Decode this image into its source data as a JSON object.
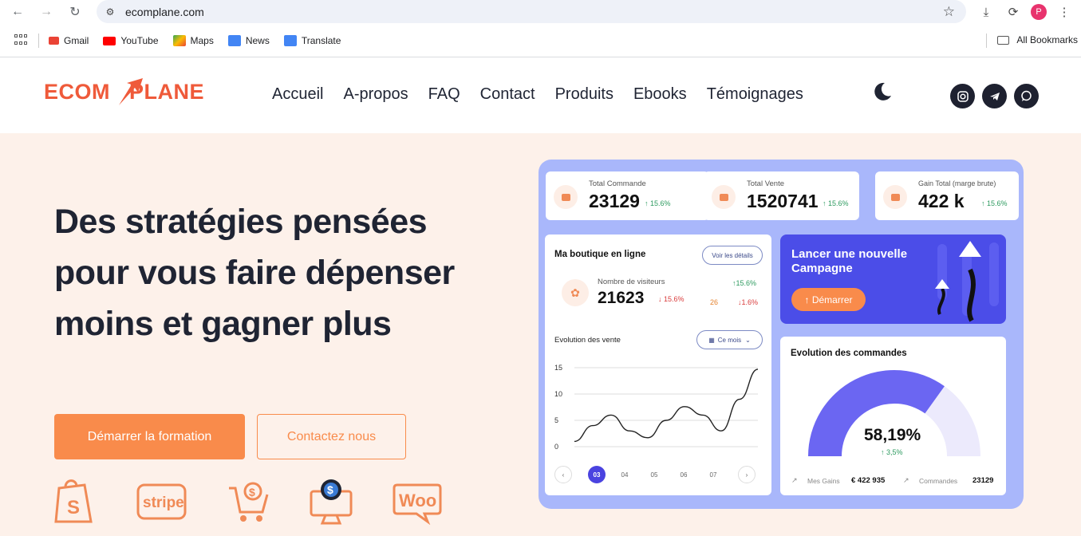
{
  "browser": {
    "url": "ecomplane.com",
    "bookmarks": [
      {
        "label": "Gmail",
        "color": "#ea4335"
      },
      {
        "label": "YouTube",
        "color": "#ff0000"
      },
      {
        "label": "Maps",
        "color": "#34a853"
      },
      {
        "label": "News",
        "color": "#4285f4"
      },
      {
        "label": "Translate",
        "color": "#4285f4"
      }
    ],
    "all_bookmarks": "All Bookmarks",
    "profile_initial": "P"
  },
  "site": {
    "logo_left": "ECOM",
    "logo_right": "PLANE",
    "menu": [
      "Accueil",
      "A-propos",
      "FAQ",
      "Contact",
      "Produits",
      "Ebooks",
      "Témoignages"
    ],
    "social": [
      "instagram-icon",
      "telegram-icon",
      "whatsapp-icon"
    ]
  },
  "hero": {
    "title": "Des stratégies pensées pour vous faire dépenser moins et gagner plus",
    "primary_button": "Démarrer la formation",
    "secondary_button": "Contactez nous",
    "brands": [
      "shopify-icon",
      "stripe-icon",
      "cart-dollar-icon",
      "monitor-dollar-icon",
      "woo-icon"
    ],
    "stripe_text": "stripe",
    "woo_text": "Woo"
  },
  "dashboard": {
    "stats": [
      {
        "label": "Total Commande",
        "value": "23129",
        "delta": "↑ 15.6%"
      },
      {
        "label": "Total Vente",
        "value": "1520741",
        "delta": "↑ 15.6%"
      },
      {
        "label": "Gain Total (marge brute)",
        "value": "422 k",
        "delta": "↑ 15.6%"
      }
    ],
    "shop": {
      "title": "Ma boutique en ligne",
      "details_button": "Voir les détails",
      "visitors_label": "Nombre de visiteurs",
      "visitors_value": "21623",
      "visitors_delta": "↓ 15.6%",
      "side_up": "↑15.6%",
      "side_value": "26",
      "side_down": "↓1.6%",
      "chart_title": "Evolution des vente",
      "period": "Ce mois",
      "pages": [
        "03",
        "04",
        "05",
        "06",
        "07"
      ]
    },
    "campaign": {
      "title": "Lancer une nouvelle Campagne",
      "button": "↑ Démarrer"
    },
    "orders": {
      "title": "Evolution des commandes",
      "percent": "58,19%",
      "percent_value": 58.19,
      "delta": "↑ 3,5%",
      "gains_label": "Mes Gains",
      "gains_value": "€ 422 935",
      "orders_label": "Commandes",
      "orders_value": "23129"
    }
  },
  "chart_data": {
    "type": "line",
    "title": "Evolution des vente",
    "xlabel": "",
    "ylabel": "",
    "yticks": [
      "0",
      "5",
      "10",
      "15"
    ],
    "ylim": [
      0,
      15
    ],
    "x": [
      0,
      1,
      2,
      3,
      4,
      5,
      6,
      7,
      8,
      9,
      10
    ],
    "values": [
      1,
      4,
      6,
      3,
      1.7,
      5,
      7.6,
      6,
      3,
      9,
      14.7
    ],
    "colors": {
      "line": "#222",
      "grid": "#dddddd"
    }
  }
}
